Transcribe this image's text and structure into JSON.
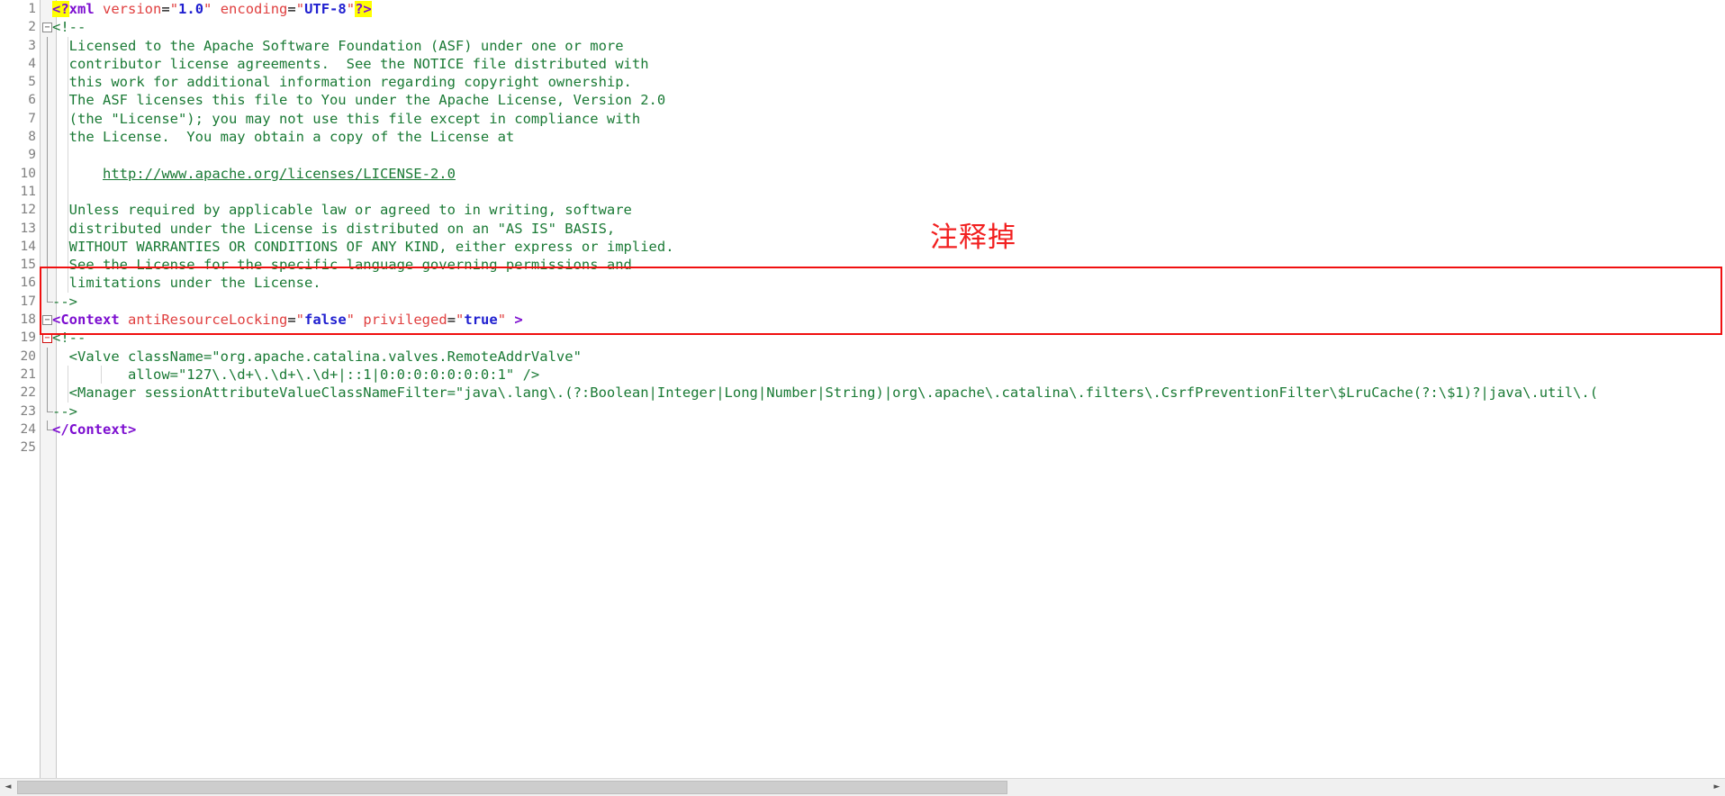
{
  "editor": {
    "language": "XML",
    "colors": {
      "comment": "#1a7a35",
      "tag": "#7d0fd0",
      "attribute": "#e04040",
      "value": "#2020d0",
      "highlight": "#ffff00",
      "annotation": "#f22020",
      "box_border": "#f01010",
      "line_number": "#808080",
      "background": "#ffffff"
    },
    "line_numbers": [
      "1",
      "2",
      "3",
      "4",
      "5",
      "6",
      "7",
      "8",
      "9",
      "10",
      "11",
      "12",
      "13",
      "14",
      "15",
      "16",
      "17",
      "18",
      "19",
      "20",
      "21",
      "22",
      "23",
      "24",
      "25"
    ],
    "lines": [
      {
        "n": "1",
        "fold": "none",
        "text": "<?xml version=\"1.0\" encoding=\"UTF-8\"?>"
      },
      {
        "n": "2",
        "fold": "open",
        "text": "<!--"
      },
      {
        "n": "3",
        "fold": "body",
        "text": "  Licensed to the Apache Software Foundation (ASF) under one or more"
      },
      {
        "n": "4",
        "fold": "body",
        "text": "  contributor license agreements.  See the NOTICE file distributed with"
      },
      {
        "n": "5",
        "fold": "body",
        "text": "  this work for additional information regarding copyright ownership."
      },
      {
        "n": "6",
        "fold": "body",
        "text": "  The ASF licenses this file to You under the Apache License, Version 2.0"
      },
      {
        "n": "7",
        "fold": "body",
        "text": "  (the \"License\"); you may not use this file except in compliance with"
      },
      {
        "n": "8",
        "fold": "body",
        "text": "  the License.  You may obtain a copy of the License at"
      },
      {
        "n": "9",
        "fold": "body",
        "text": ""
      },
      {
        "n": "10",
        "fold": "body",
        "text": "      http://www.apache.org/licenses/LICENSE-2.0"
      },
      {
        "n": "11",
        "fold": "body",
        "text": ""
      },
      {
        "n": "12",
        "fold": "body",
        "text": "  Unless required by applicable law or agreed to in writing, software"
      },
      {
        "n": "13",
        "fold": "body",
        "text": "  distributed under the License is distributed on an \"AS IS\" BASIS,"
      },
      {
        "n": "14",
        "fold": "body",
        "text": "  WITHOUT WARRANTIES OR CONDITIONS OF ANY KIND, either express or implied."
      },
      {
        "n": "15",
        "fold": "body",
        "text": "  See the License for the specific language governing permissions and"
      },
      {
        "n": "16",
        "fold": "body",
        "text": "  limitations under the License."
      },
      {
        "n": "17",
        "fold": "close",
        "text": "-->"
      },
      {
        "n": "18",
        "fold": "open",
        "text": "<Context antiResourceLocking=\"false\" privileged=\"true\" >"
      },
      {
        "n": "19",
        "fold": "open",
        "text": "<!--"
      },
      {
        "n": "20",
        "fold": "body",
        "text": "  <Valve className=\"org.apache.catalina.valves.RemoteAddrValve\""
      },
      {
        "n": "21",
        "fold": "body",
        "text": "         allow=\"127\\.\\d+\\.\\d+\\.\\d+|::1|0:0:0:0:0:0:0:1\" />"
      },
      {
        "n": "22",
        "fold": "body",
        "text": "  <Manager sessionAttributeValueClassNameFilter=\"java\\.lang\\.(?:Boolean|Integer|Long|Number|String)|org\\.apache\\.catalina\\.filters\\.CsrfPreventionFilter\\$LruCache(?:\\$1)?|java\\.util\\.("
      },
      {
        "n": "23",
        "fold": "close",
        "text": "-->"
      },
      {
        "n": "24",
        "fold": "close",
        "text": "</Context>"
      },
      {
        "n": "25",
        "fold": "none",
        "text": ""
      }
    ],
    "line_01_tokens": [
      {
        "cls": "t-hl",
        "s": "<?"
      },
      {
        "cls": "t-pi",
        "s": "xml"
      },
      {
        "cls": "t-plain",
        "s": " "
      },
      {
        "cls": "t-attr",
        "s": "version"
      },
      {
        "cls": "t-plain",
        "s": "="
      },
      {
        "cls": "t-quote",
        "s": "\""
      },
      {
        "cls": "t-val",
        "s": "1.0"
      },
      {
        "cls": "t-quote",
        "s": "\""
      },
      {
        "cls": "t-plain",
        "s": " "
      },
      {
        "cls": "t-attr",
        "s": "encoding"
      },
      {
        "cls": "t-plain",
        "s": "="
      },
      {
        "cls": "t-quote",
        "s": "\""
      },
      {
        "cls": "t-val",
        "s": "UTF-8"
      },
      {
        "cls": "t-quote",
        "s": "\""
      },
      {
        "cls": "t-hl",
        "s": "?>"
      }
    ],
    "line_18_tokens": [
      {
        "cls": "t-tag",
        "s": "<Context"
      },
      {
        "cls": "t-plain",
        "s": " "
      },
      {
        "cls": "t-attr",
        "s": "antiResourceLocking"
      },
      {
        "cls": "t-plain",
        "s": "="
      },
      {
        "cls": "t-quote",
        "s": "\""
      },
      {
        "cls": "t-val",
        "s": "false"
      },
      {
        "cls": "t-quote",
        "s": "\""
      },
      {
        "cls": "t-plain",
        "s": " "
      },
      {
        "cls": "t-attr",
        "s": "privileged"
      },
      {
        "cls": "t-plain",
        "s": "="
      },
      {
        "cls": "t-quote",
        "s": "\""
      },
      {
        "cls": "t-val",
        "s": "true"
      },
      {
        "cls": "t-quote",
        "s": "\""
      },
      {
        "cls": "t-tag",
        "s": " >"
      }
    ],
    "line_24_tokens": [
      {
        "cls": "t-tag",
        "s": "</Context>"
      }
    ],
    "link_line": {
      "prefix": "      ",
      "url": "http://www.apache.org/licenses/LICENSE-2.0"
    },
    "fold_glyphs": {
      "open": "−",
      "close": "└"
    }
  },
  "annotation": {
    "text": "注释掉"
  },
  "scrollbar": {
    "left_arrow": "◄",
    "right_arrow": "►"
  }
}
